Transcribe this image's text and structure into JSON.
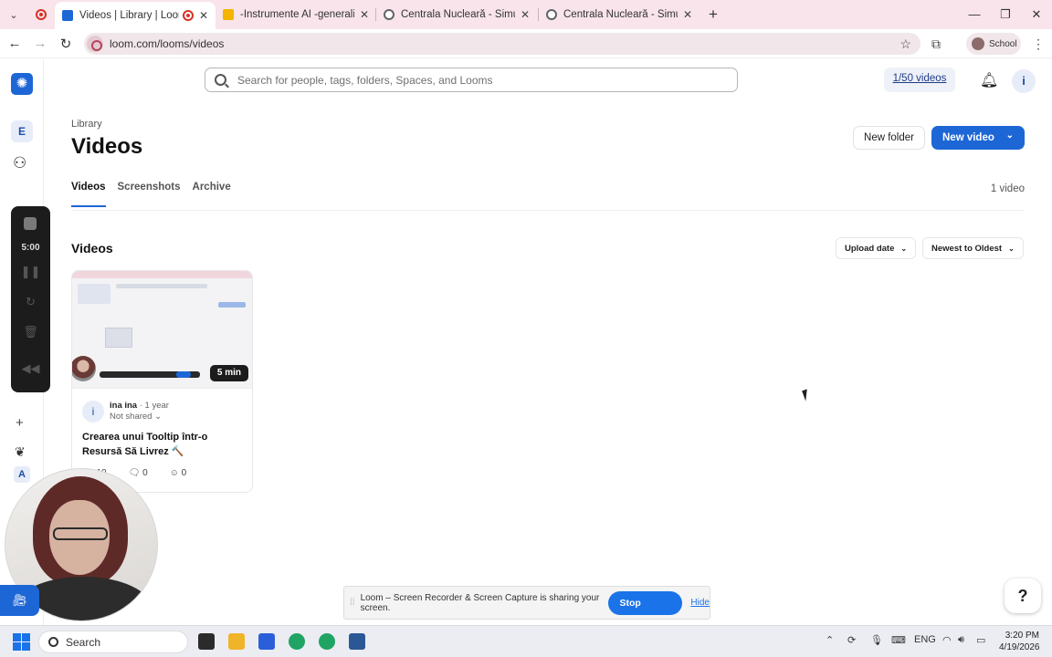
{
  "browser": {
    "tabs": [
      {
        "title": "Videos | Library | Loom",
        "active": true,
        "favicon_color": "#1d66d6"
      },
      {
        "title": "-Instrumente AI -generalități - I",
        "active": false,
        "favicon_color": "#f4b400"
      },
      {
        "title": "Centrala Nucleară - Simulare In",
        "active": false,
        "favicon_color": "#5f6368"
      },
      {
        "title": "Centrala Nucleară - Simulare C",
        "active": false,
        "favicon_color": "#5f6368"
      }
    ],
    "url": "loom.com/looms/videos",
    "profile_label": "School",
    "glyphs": {
      "dropdown": "⌄",
      "close": "✕",
      "new_tab": "+",
      "minimize": "—",
      "restore": "❐",
      "back": "←",
      "forward": "→",
      "reload": "↻",
      "star": "☆",
      "extensions": "⧉",
      "menu": "⋮"
    }
  },
  "rail": {
    "workspace_initial": "E",
    "workspace_a": "A",
    "recorder_time": "5:00"
  },
  "header": {
    "search_placeholder": "Search for people, tags, folders, Spaces, and Looms",
    "quota": "1/50 videos",
    "user_initial": "i"
  },
  "page": {
    "breadcrumb": "Library",
    "title": "Videos",
    "new_folder_label": "New folder",
    "new_video_label": "New video",
    "tabs": [
      "Videos",
      "Screenshots",
      "Archive"
    ],
    "video_count": "1 video",
    "section_title": "Videos",
    "sort_field": "Upload date",
    "sort_order": "Newest to Oldest"
  },
  "video": {
    "duration": "5 min",
    "owner_initial": "i",
    "owner": "ina ina",
    "age": "· 1 year",
    "share_status": "Not shared",
    "title": "Crearea unui Tooltip într-o Resursă Să Livrez 🔨",
    "views": "10",
    "comments": "0",
    "reactions": "0"
  },
  "sharebar": {
    "message": "Loom – Screen Recorder & Screen Capture is sharing your screen.",
    "stop_label": "Stop sharing",
    "hide_label": "Hide"
  },
  "help_label": "?",
  "taskbar": {
    "search_label": "Search",
    "language": "ENG",
    "time": "3:20 PM",
    "date": "4/19/2026",
    "app_colors": [
      "#2b2b2b",
      "#f0b429",
      "#2b5fd9",
      "#1fa463",
      "#1fa463",
      "#2b5797"
    ]
  },
  "colors": {
    "accent": "#1d66d6",
    "tab_strip": "#f8e4ea"
  }
}
